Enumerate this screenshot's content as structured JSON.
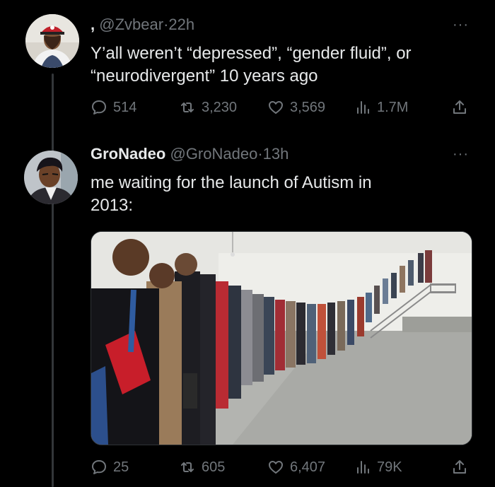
{
  "tweets": [
    {
      "display_name": ",",
      "handle": "@Zvbear",
      "time": "22h",
      "text_line1": "Y’all weren’t “depressed”, “gender fluid”, or",
      "text_line2": "“neurodivergent” 10 years ago",
      "replies": "514",
      "retweets": "3,230",
      "likes": "3,569",
      "views": "1.7M",
      "more_icon": "···"
    },
    {
      "display_name": "GroNadeo",
      "handle": "@GroNadeo",
      "time": "13h",
      "text_line1": "me waiting for the launch of Autism in",
      "text_line2": "2013:",
      "replies": "25",
      "retweets": "605",
      "likes": "6,407",
      "views": "79K",
      "more_icon": "···"
    }
  ],
  "separator": "·",
  "colors": {
    "background": "#000000",
    "text": "#e7e9ea",
    "secondary": "#71767b",
    "thread_line": "#333639"
  },
  "icons": [
    "reply-icon",
    "retweet-icon",
    "like-icon",
    "views-icon",
    "share-icon"
  ]
}
